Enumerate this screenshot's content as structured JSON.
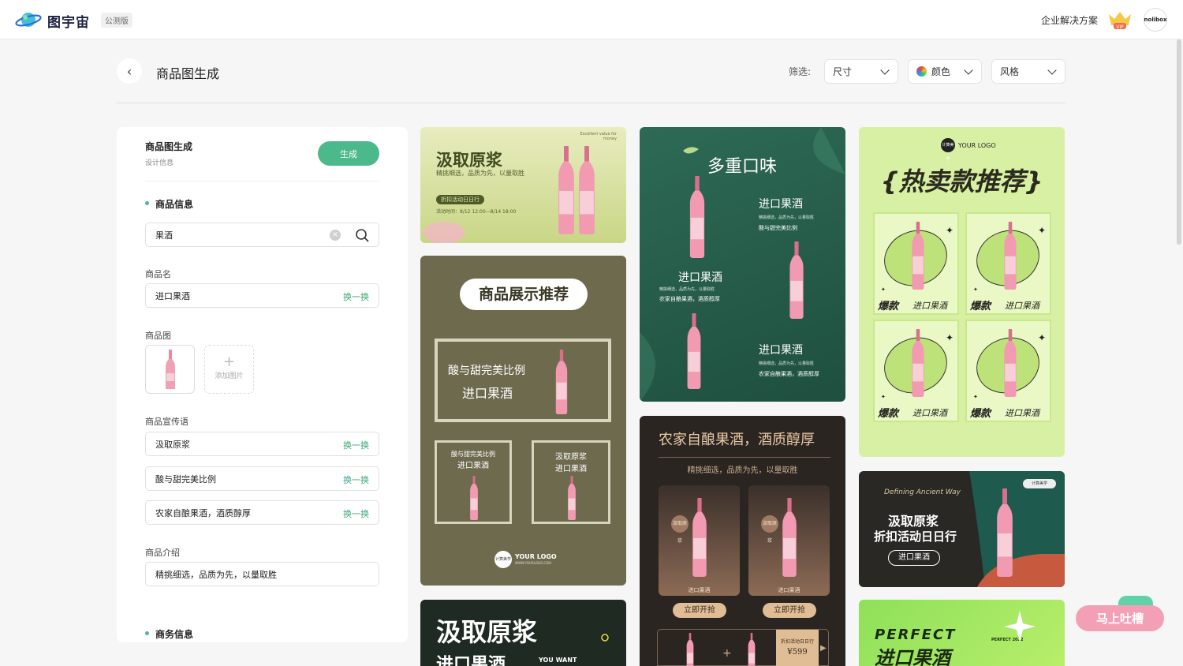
{
  "topbar": {
    "brand": "图宇宙",
    "beta": "公测版",
    "enterprise": "企业解决方案",
    "avatar": "nolibox",
    "vip": "VIP"
  },
  "page": {
    "title": "商品图生成",
    "filter_label": "筛选:"
  },
  "filters": {
    "size": "尺寸",
    "color": "颜色",
    "style": "风格"
  },
  "panel": {
    "title": "商品图生成",
    "subtitle": "设计信息",
    "generate": "生成",
    "section_product": "商品信息",
    "search_value": "果酒",
    "name_label": "商品名",
    "name_value": "进口果酒",
    "swap": "换一换",
    "image_label": "商品图",
    "add_image": "添加图片",
    "slogan_label": "商品宣传语",
    "slogans": [
      "汲取原浆",
      "酸与甜完美比例",
      "农家自酿果酒，酒质醇厚"
    ],
    "intro_label": "商品介绍",
    "intro_value": "精挑细选，品质为先，以量取胜",
    "section_business": "商务信息"
  },
  "cards": {
    "c1": {
      "title": "汲取原浆",
      "sub": "精挑细选，品质为先，以量取胜",
      "tag": "折扣活动日日行",
      "date": "活动时间：8/12 12:00—8/14 18:00",
      "corner": "Excellent value for money"
    },
    "c2": {
      "title": "商品展示推荐",
      "line1": "酸与甜完美比例",
      "line2": "进口果酒",
      "s1a": "酸与甜完美比例",
      "s1b": "进口果酒",
      "s2a": "汲取原浆",
      "s2b": "进口果酒",
      "logo": "YOUR LOGO",
      "logo_badge": "计算美学",
      "logo_url": "WWW.YOURLOGO.COM"
    },
    "c3": {
      "title": "汲取原浆",
      "sub": "进口果酒",
      "tag": "YOU WANT"
    },
    "c4": {
      "title": "多重口味",
      "h1": "进口果酒",
      "d1a": "精挑细选，品质为先，以量取胜",
      "d1b": "酸与甜完美比例",
      "h2": "进口果酒",
      "d2a": "精挑细选，品质为先，以量取胜",
      "d2b": "农家自酿果酒，酒质醇厚",
      "h3": "进口果酒",
      "d3a": "精挑细选，品质为先，以量取胜",
      "d3b": "农家自酿果酒，酒质醇厚"
    },
    "c5": {
      "title": "农家自酿果酒，酒质醇厚",
      "sub": "精挑细选，品质为先，以量取胜",
      "badge": "汲取原浆",
      "p1": "进口果酒",
      "p2": "进口果酒",
      "buy": "立即开抢",
      "tag": "折扣活动日日行",
      "price": "¥599"
    },
    "c6": {
      "logo": "YOUR LOGO",
      "logo_badge": "计算美学",
      "title": "{热卖款推荐}",
      "hot": "爆款",
      "item": "进口果酒"
    },
    "c7": {
      "script": "Defining Ancient Way",
      "t1": "汲取原浆",
      "t2": "折扣活动日日行",
      "pill": "进口果酒",
      "badge": "计算美学"
    },
    "c8": {
      "t1": "PERFECT",
      "t2": "进口果酒",
      "small": "PERFECT 2022"
    }
  },
  "feedback": "马上吐槽"
}
